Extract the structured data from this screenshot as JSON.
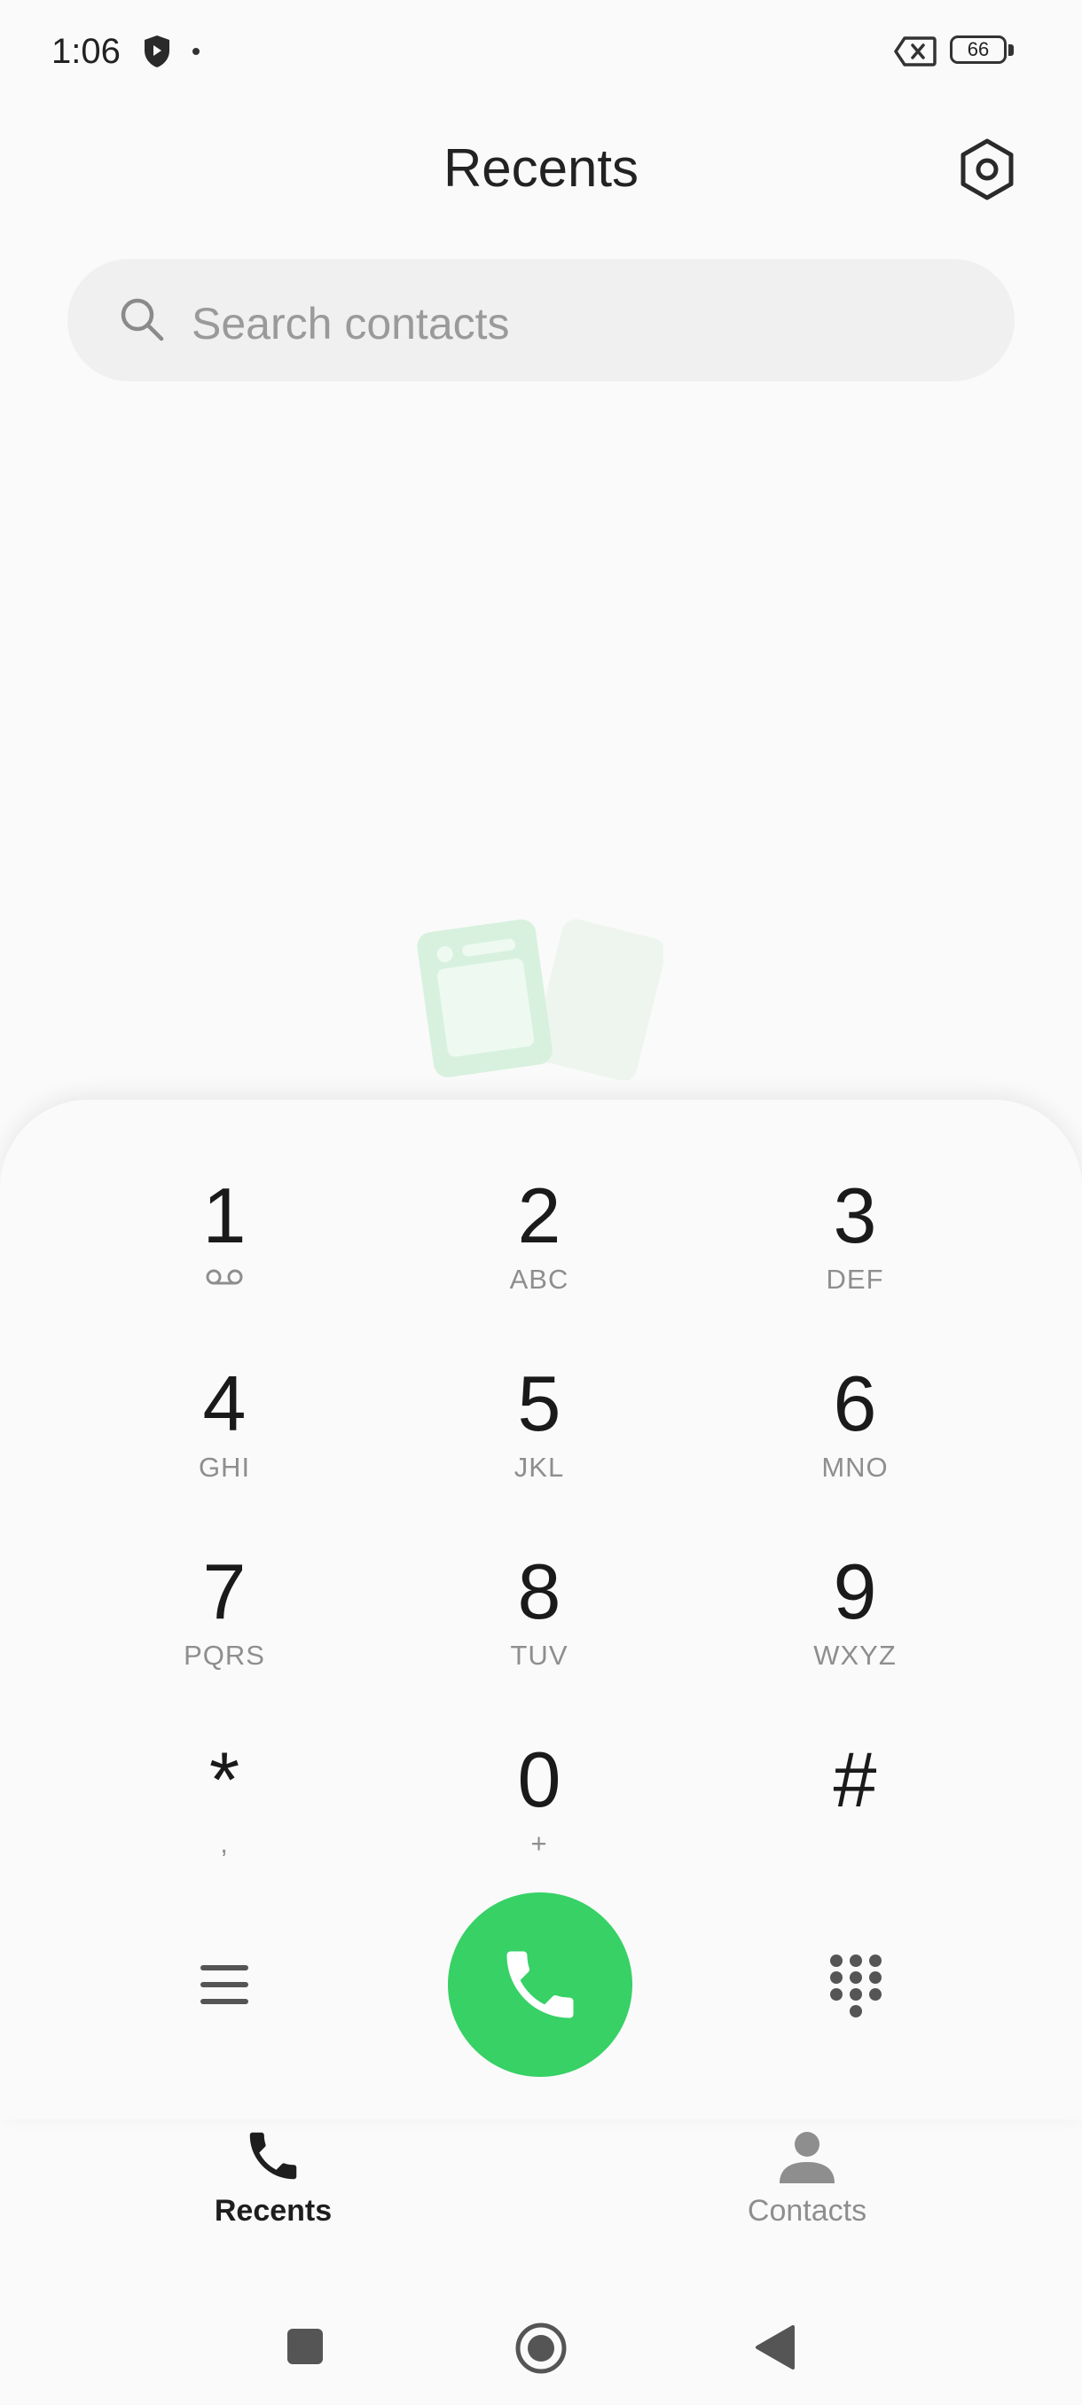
{
  "status_bar": {
    "time": "1:06",
    "battery_level": "66"
  },
  "header": {
    "title": "Recents"
  },
  "search": {
    "placeholder": "Search contacts"
  },
  "dialpad": {
    "keys": [
      {
        "digit": "1",
        "letters": ""
      },
      {
        "digit": "2",
        "letters": "ABC"
      },
      {
        "digit": "3",
        "letters": "DEF"
      },
      {
        "digit": "4",
        "letters": "GHI"
      },
      {
        "digit": "5",
        "letters": "JKL"
      },
      {
        "digit": "6",
        "letters": "MNO"
      },
      {
        "digit": "7",
        "letters": "PQRS"
      },
      {
        "digit": "8",
        "letters": "TUV"
      },
      {
        "digit": "9",
        "letters": "WXYZ"
      },
      {
        "digit": "*",
        "letters": ","
      },
      {
        "digit": "0",
        "letters": "+"
      },
      {
        "digit": "#",
        "letters": ""
      }
    ]
  },
  "tabs": [
    {
      "label": "Recents",
      "active": true
    },
    {
      "label": "Contacts",
      "active": false
    }
  ],
  "colors": {
    "call_green": "#37d166",
    "background": "#fafafa",
    "search_bg": "#f0f0f0"
  },
  "icons": [
    "shield-icon",
    "dismiss-notification-icon",
    "battery-icon",
    "settings-icon",
    "search-icon",
    "voicemail-icon",
    "menu-icon",
    "phone-icon",
    "dialpad-icon",
    "person-icon",
    "recents-square-icon",
    "home-circle-icon",
    "back-triangle-icon"
  ]
}
